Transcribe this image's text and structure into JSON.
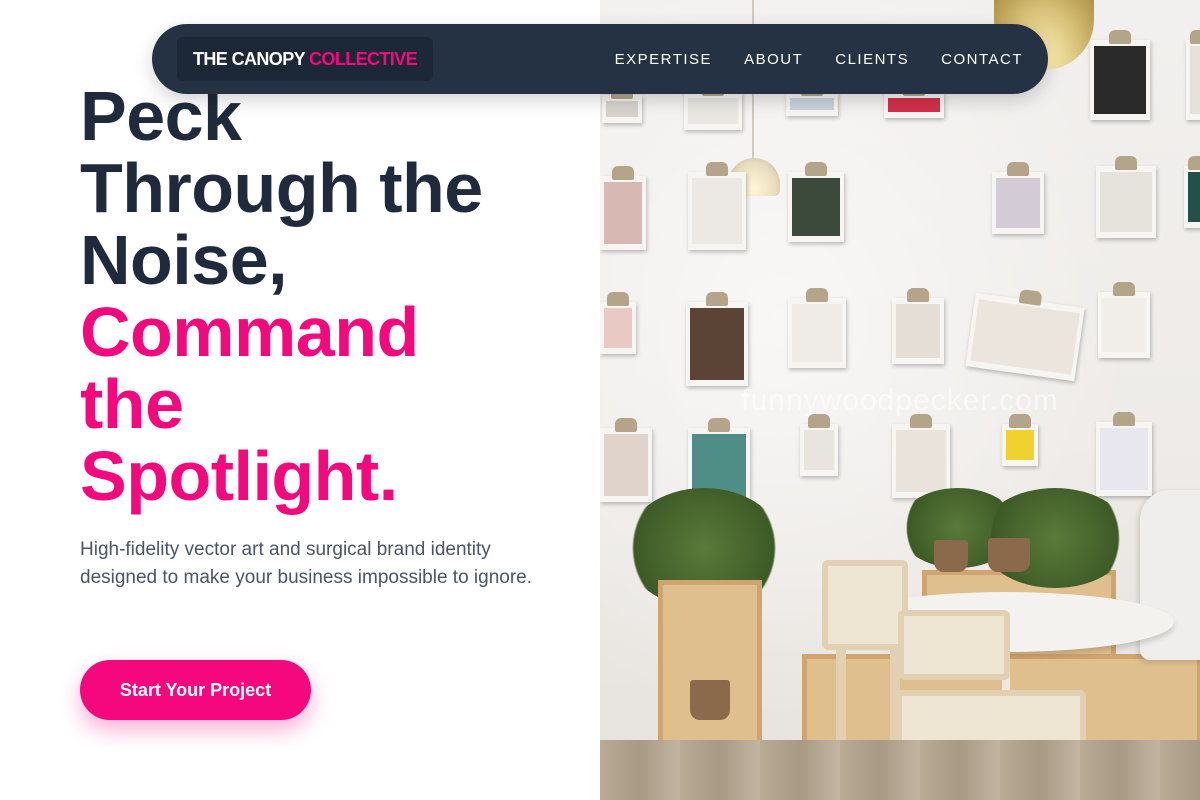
{
  "nav": {
    "logo_main": "THE CANOPY",
    "logo_accent": "COLLECTIVE",
    "links": [
      {
        "label": "EXPERTISE"
      },
      {
        "label": "ABOUT"
      },
      {
        "label": "CLIENTS"
      },
      {
        "label": "CONTACT"
      }
    ]
  },
  "hero": {
    "headline_lines": [
      "Peck",
      "Through the",
      "Noise,"
    ],
    "headline_accent_lines": [
      "Command",
      "the",
      "Spotlight."
    ],
    "subtext": "High-fidelity vector art and surgical brand identity designed to make your business impossible to ignore.",
    "cta_label": "Start Your Project"
  },
  "photo": {
    "watermark": "funnywoodpecker.com"
  },
  "colors": {
    "navy": "#253244",
    "heading": "#1f2a3c",
    "accent_pink": "#f5077d",
    "body_text": "#4a5565",
    "background": "#ffffff"
  }
}
